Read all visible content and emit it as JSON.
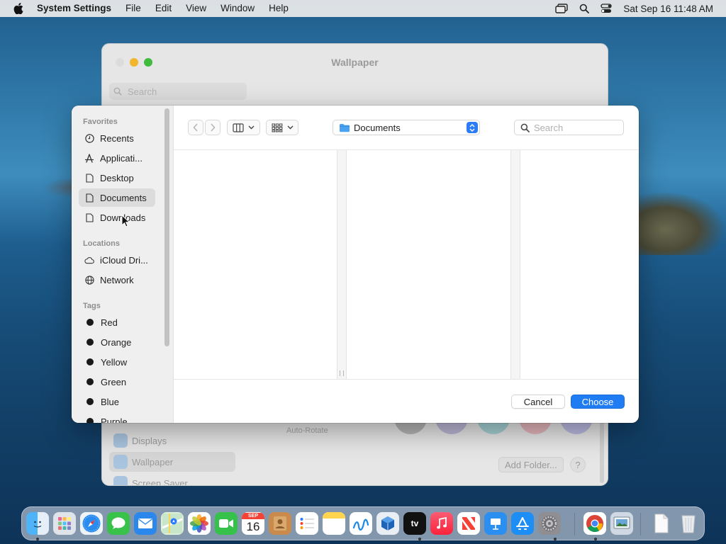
{
  "menubar": {
    "app_name": "System Settings",
    "items": [
      "File",
      "Edit",
      "View",
      "Window",
      "Help"
    ],
    "clock": "Sat Sep 16  11:48 AM",
    "status_icons": [
      "screen-mirroring-icon",
      "spotlight-search-icon",
      "control-center-icon"
    ]
  },
  "settings_window": {
    "title": "Wallpaper",
    "search_placeholder": "Search",
    "sidebar": [
      {
        "label": "Displays",
        "selected": false
      },
      {
        "label": "Wallpaper",
        "selected": true
      },
      {
        "label": "Screen Saver",
        "selected": false
      }
    ],
    "auto_rotate_label": "Auto-Rotate",
    "add_folder_label": "Add Folder...",
    "help_label": "?"
  },
  "dialog": {
    "sidebar": {
      "favorites_header": "Favorites",
      "favorites": [
        {
          "label": "Recents",
          "icon": "clock-icon"
        },
        {
          "label": "Applicati...",
          "icon": "applications-icon"
        },
        {
          "label": "Desktop",
          "icon": "document-icon"
        },
        {
          "label": "Documents",
          "icon": "document-icon",
          "selected": true
        },
        {
          "label": "Downloads",
          "icon": "document-icon"
        }
      ],
      "locations_header": "Locations",
      "locations": [
        {
          "label": "iCloud Dri...",
          "icon": "cloud-icon"
        },
        {
          "label": "Network",
          "icon": "globe-icon"
        }
      ],
      "tags_header": "Tags",
      "tags": [
        {
          "label": "Red"
        },
        {
          "label": "Orange"
        },
        {
          "label": "Yellow"
        },
        {
          "label": "Green"
        },
        {
          "label": "Blue"
        },
        {
          "label": "Purple"
        }
      ]
    },
    "path_popup": "Documents",
    "search_placeholder": "Search",
    "cancel_label": "Cancel",
    "choose_label": "Choose"
  },
  "dock": {
    "apps": [
      "Finder",
      "Launchpad",
      "Safari",
      "Messages",
      "Mail",
      "Maps",
      "Photos",
      "FaceTime",
      "Calendar",
      "Contacts",
      "Reminders",
      "Notes",
      "Freeform",
      "VirtualBox",
      "TV",
      "Music",
      "News",
      "Keynote",
      "App Store",
      "System Settings",
      "Chrome",
      "Preview",
      "Document",
      "Trash"
    ],
    "calendar_month": "SEP",
    "calendar_day": "16",
    "tv_label": "tv"
  }
}
